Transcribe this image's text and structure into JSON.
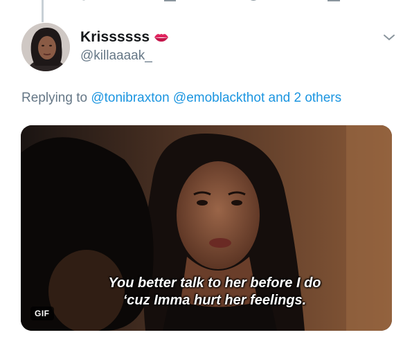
{
  "tweet": {
    "display_name": "Krissssss",
    "handle": "@killaaaak_",
    "replying_prefix": "Replying to",
    "mentions": [
      "@tonibraxton",
      "@emoblackthot"
    ],
    "others_text": "and 2 others",
    "name_emoji_icon": "lips-kiss-icon",
    "menu_icon": "chevron-down-icon"
  },
  "media": {
    "caption_line1": "You better talk to her before I do",
    "caption_line2": "‘cuz Imma hurt her feelings.",
    "badge": "GIF"
  },
  "colors": {
    "link": "#1b95e0",
    "secondary_text": "#657786",
    "primary_text": "#14171a",
    "thread_line": "#c8d0d6"
  }
}
